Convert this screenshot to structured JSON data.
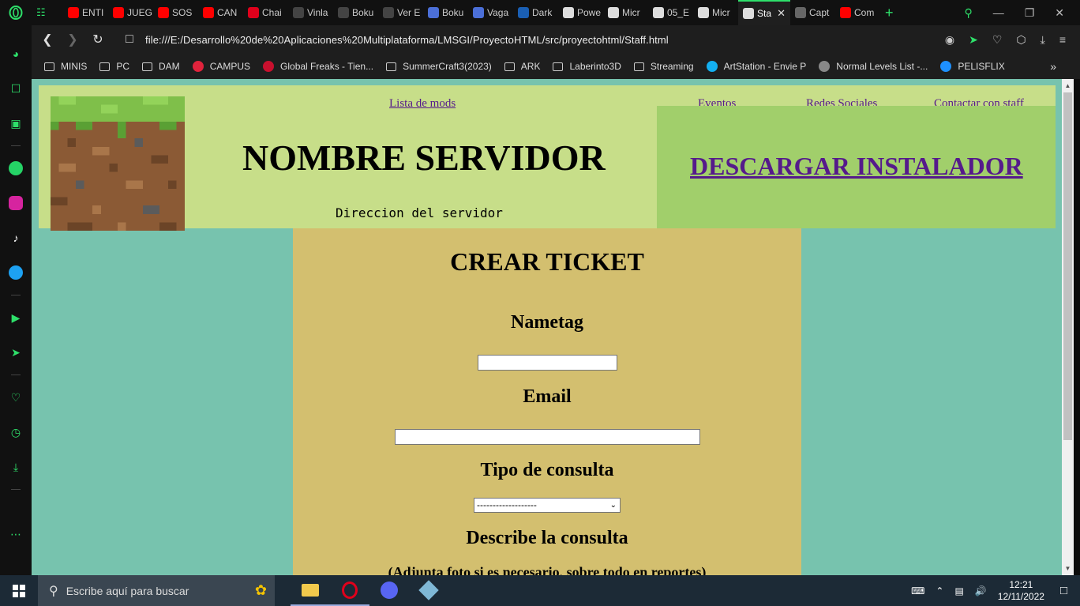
{
  "browser": {
    "tabs": [
      {
        "label": "ENTI",
        "color": "#ff0000"
      },
      {
        "label": "JUEG",
        "color": "#ff0000"
      },
      {
        "label": "SOS",
        "color": "#ff0000"
      },
      {
        "label": "CAN",
        "color": "#ff0000"
      },
      {
        "label": "Chai",
        "color": "#e0001b"
      },
      {
        "label": "Vinla",
        "color": "#444444"
      },
      {
        "label": "Boku",
        "color": "#444444"
      },
      {
        "label": "Ver E",
        "color": "#444444"
      },
      {
        "label": "Boku",
        "color": "#4b6fd8"
      },
      {
        "label": "Vaga",
        "color": "#4b6fd8"
      },
      {
        "label": "Dark",
        "color": "#1a5fb4"
      },
      {
        "label": "Powe",
        "color": "#dddddd"
      },
      {
        "label": "Micr",
        "color": "#dddddd"
      },
      {
        "label": "05_E",
        "color": "#dddddd"
      },
      {
        "label": "Micr",
        "color": "#dddddd"
      },
      {
        "label": "Sta",
        "color": "#dddddd",
        "active": true
      },
      {
        "label": "Capt",
        "color": "#666666"
      },
      {
        "label": "Com",
        "color": "#ff0000"
      }
    ],
    "url": "file:///E:/Desarrollo%20de%20Aplicaciones%20Multiplataforma/LMSGI/ProyectoHTML/src/proyectohtml/Staff.html",
    "bookmarks": [
      {
        "label": "MINIS",
        "icon": "folder-icon"
      },
      {
        "label": "PC",
        "icon": "folder-icon"
      },
      {
        "label": "DAM",
        "icon": "folder-icon"
      },
      {
        "label": "CAMPUS",
        "icon": "site-icon",
        "color": "#e0233c"
      },
      {
        "label": "Global Freaks - Tien...",
        "icon": "site-icon",
        "color": "#c8102e"
      },
      {
        "label": "SummerCraft3(2023)",
        "icon": "folder-icon"
      },
      {
        "label": "ARK",
        "icon": "folder-icon"
      },
      {
        "label": "Laberinto3D",
        "icon": "folder-icon"
      },
      {
        "label": "Streaming",
        "icon": "folder-icon"
      },
      {
        "label": "ArtStation - Envie P",
        "icon": "site-icon",
        "color": "#13aff0"
      },
      {
        "label": "Normal Levels List -...",
        "icon": "site-icon",
        "color": "#888888"
      },
      {
        "label": "PELISFLIX",
        "icon": "site-icon",
        "color": "#1e90ff"
      }
    ]
  },
  "site": {
    "nav": {
      "mods": "Lista de mods",
      "events": "Eventos",
      "social": "Redes Sociales",
      "contact": "Contactar con staff"
    },
    "title": "NOMBRE SERVIDOR",
    "server_address": "Direccion del servidor",
    "download": "DESCARGAR INSTALADOR"
  },
  "form": {
    "heading": "CREAR TICKET",
    "nametag_label": "Nametag",
    "nametag_value": "",
    "email_label": "Email",
    "email_value": "",
    "type_label": "Tipo de consulta",
    "type_selected": "-------------------",
    "describe_label": "Describe la consulta",
    "describe_note": "(Adjunta foto si es necesario, sobre todo en reportes)"
  },
  "taskbar": {
    "search_placeholder": "Escribe aquí para buscar",
    "time": "12:21",
    "date": "12/11/2022"
  },
  "colors": {
    "page_bg": "#77c3ae",
    "header_bg": "#c7de89",
    "download_bg": "#a1cf6b",
    "form_bg": "#d3bf6f",
    "accent": "#2ee06a"
  }
}
